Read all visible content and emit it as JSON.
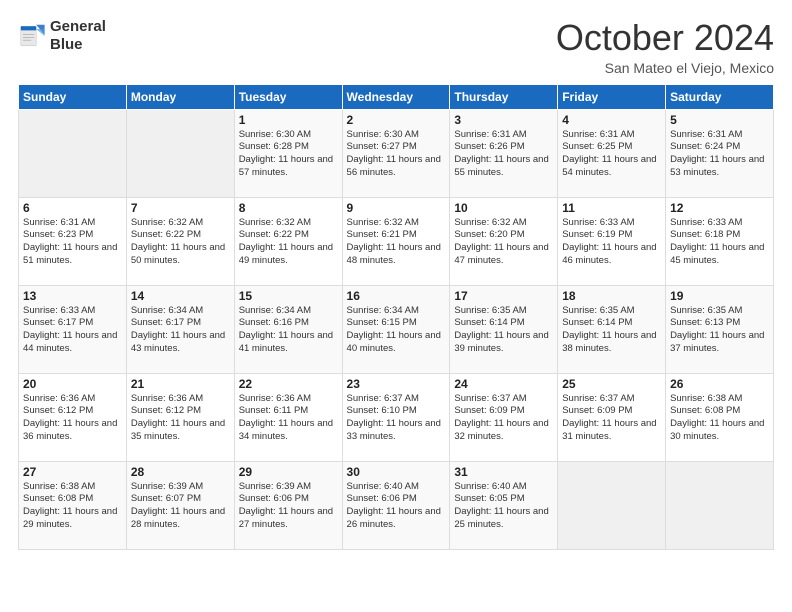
{
  "logo": {
    "line1": "General",
    "line2": "Blue"
  },
  "title": "October 2024",
  "location": "San Mateo el Viejo, Mexico",
  "weekdays": [
    "Sunday",
    "Monday",
    "Tuesday",
    "Wednesday",
    "Thursday",
    "Friday",
    "Saturday"
  ],
  "weeks": [
    [
      {
        "day": "",
        "sunrise": "",
        "sunset": "",
        "daylight": ""
      },
      {
        "day": "",
        "sunrise": "",
        "sunset": "",
        "daylight": ""
      },
      {
        "day": "1",
        "sunrise": "Sunrise: 6:30 AM",
        "sunset": "Sunset: 6:28 PM",
        "daylight": "Daylight: 11 hours and 57 minutes."
      },
      {
        "day": "2",
        "sunrise": "Sunrise: 6:30 AM",
        "sunset": "Sunset: 6:27 PM",
        "daylight": "Daylight: 11 hours and 56 minutes."
      },
      {
        "day": "3",
        "sunrise": "Sunrise: 6:31 AM",
        "sunset": "Sunset: 6:26 PM",
        "daylight": "Daylight: 11 hours and 55 minutes."
      },
      {
        "day": "4",
        "sunrise": "Sunrise: 6:31 AM",
        "sunset": "Sunset: 6:25 PM",
        "daylight": "Daylight: 11 hours and 54 minutes."
      },
      {
        "day": "5",
        "sunrise": "Sunrise: 6:31 AM",
        "sunset": "Sunset: 6:24 PM",
        "daylight": "Daylight: 11 hours and 53 minutes."
      }
    ],
    [
      {
        "day": "6",
        "sunrise": "Sunrise: 6:31 AM",
        "sunset": "Sunset: 6:23 PM",
        "daylight": "Daylight: 11 hours and 51 minutes."
      },
      {
        "day": "7",
        "sunrise": "Sunrise: 6:32 AM",
        "sunset": "Sunset: 6:22 PM",
        "daylight": "Daylight: 11 hours and 50 minutes."
      },
      {
        "day": "8",
        "sunrise": "Sunrise: 6:32 AM",
        "sunset": "Sunset: 6:22 PM",
        "daylight": "Daylight: 11 hours and 49 minutes."
      },
      {
        "day": "9",
        "sunrise": "Sunrise: 6:32 AM",
        "sunset": "Sunset: 6:21 PM",
        "daylight": "Daylight: 11 hours and 48 minutes."
      },
      {
        "day": "10",
        "sunrise": "Sunrise: 6:32 AM",
        "sunset": "Sunset: 6:20 PM",
        "daylight": "Daylight: 11 hours and 47 minutes."
      },
      {
        "day": "11",
        "sunrise": "Sunrise: 6:33 AM",
        "sunset": "Sunset: 6:19 PM",
        "daylight": "Daylight: 11 hours and 46 minutes."
      },
      {
        "day": "12",
        "sunrise": "Sunrise: 6:33 AM",
        "sunset": "Sunset: 6:18 PM",
        "daylight": "Daylight: 11 hours and 45 minutes."
      }
    ],
    [
      {
        "day": "13",
        "sunrise": "Sunrise: 6:33 AM",
        "sunset": "Sunset: 6:17 PM",
        "daylight": "Daylight: 11 hours and 44 minutes."
      },
      {
        "day": "14",
        "sunrise": "Sunrise: 6:34 AM",
        "sunset": "Sunset: 6:17 PM",
        "daylight": "Daylight: 11 hours and 43 minutes."
      },
      {
        "day": "15",
        "sunrise": "Sunrise: 6:34 AM",
        "sunset": "Sunset: 6:16 PM",
        "daylight": "Daylight: 11 hours and 41 minutes."
      },
      {
        "day": "16",
        "sunrise": "Sunrise: 6:34 AM",
        "sunset": "Sunset: 6:15 PM",
        "daylight": "Daylight: 11 hours and 40 minutes."
      },
      {
        "day": "17",
        "sunrise": "Sunrise: 6:35 AM",
        "sunset": "Sunset: 6:14 PM",
        "daylight": "Daylight: 11 hours and 39 minutes."
      },
      {
        "day": "18",
        "sunrise": "Sunrise: 6:35 AM",
        "sunset": "Sunset: 6:14 PM",
        "daylight": "Daylight: 11 hours and 38 minutes."
      },
      {
        "day": "19",
        "sunrise": "Sunrise: 6:35 AM",
        "sunset": "Sunset: 6:13 PM",
        "daylight": "Daylight: 11 hours and 37 minutes."
      }
    ],
    [
      {
        "day": "20",
        "sunrise": "Sunrise: 6:36 AM",
        "sunset": "Sunset: 6:12 PM",
        "daylight": "Daylight: 11 hours and 36 minutes."
      },
      {
        "day": "21",
        "sunrise": "Sunrise: 6:36 AM",
        "sunset": "Sunset: 6:12 PM",
        "daylight": "Daylight: 11 hours and 35 minutes."
      },
      {
        "day": "22",
        "sunrise": "Sunrise: 6:36 AM",
        "sunset": "Sunset: 6:11 PM",
        "daylight": "Daylight: 11 hours and 34 minutes."
      },
      {
        "day": "23",
        "sunrise": "Sunrise: 6:37 AM",
        "sunset": "Sunset: 6:10 PM",
        "daylight": "Daylight: 11 hours and 33 minutes."
      },
      {
        "day": "24",
        "sunrise": "Sunrise: 6:37 AM",
        "sunset": "Sunset: 6:09 PM",
        "daylight": "Daylight: 11 hours and 32 minutes."
      },
      {
        "day": "25",
        "sunrise": "Sunrise: 6:37 AM",
        "sunset": "Sunset: 6:09 PM",
        "daylight": "Daylight: 11 hours and 31 minutes."
      },
      {
        "day": "26",
        "sunrise": "Sunrise: 6:38 AM",
        "sunset": "Sunset: 6:08 PM",
        "daylight": "Daylight: 11 hours and 30 minutes."
      }
    ],
    [
      {
        "day": "27",
        "sunrise": "Sunrise: 6:38 AM",
        "sunset": "Sunset: 6:08 PM",
        "daylight": "Daylight: 11 hours and 29 minutes."
      },
      {
        "day": "28",
        "sunrise": "Sunrise: 6:39 AM",
        "sunset": "Sunset: 6:07 PM",
        "daylight": "Daylight: 11 hours and 28 minutes."
      },
      {
        "day": "29",
        "sunrise": "Sunrise: 6:39 AM",
        "sunset": "Sunset: 6:06 PM",
        "daylight": "Daylight: 11 hours and 27 minutes."
      },
      {
        "day": "30",
        "sunrise": "Sunrise: 6:40 AM",
        "sunset": "Sunset: 6:06 PM",
        "daylight": "Daylight: 11 hours and 26 minutes."
      },
      {
        "day": "31",
        "sunrise": "Sunrise: 6:40 AM",
        "sunset": "Sunset: 6:05 PM",
        "daylight": "Daylight: 11 hours and 25 minutes."
      },
      {
        "day": "",
        "sunrise": "",
        "sunset": "",
        "daylight": ""
      },
      {
        "day": "",
        "sunrise": "",
        "sunset": "",
        "daylight": ""
      }
    ]
  ]
}
